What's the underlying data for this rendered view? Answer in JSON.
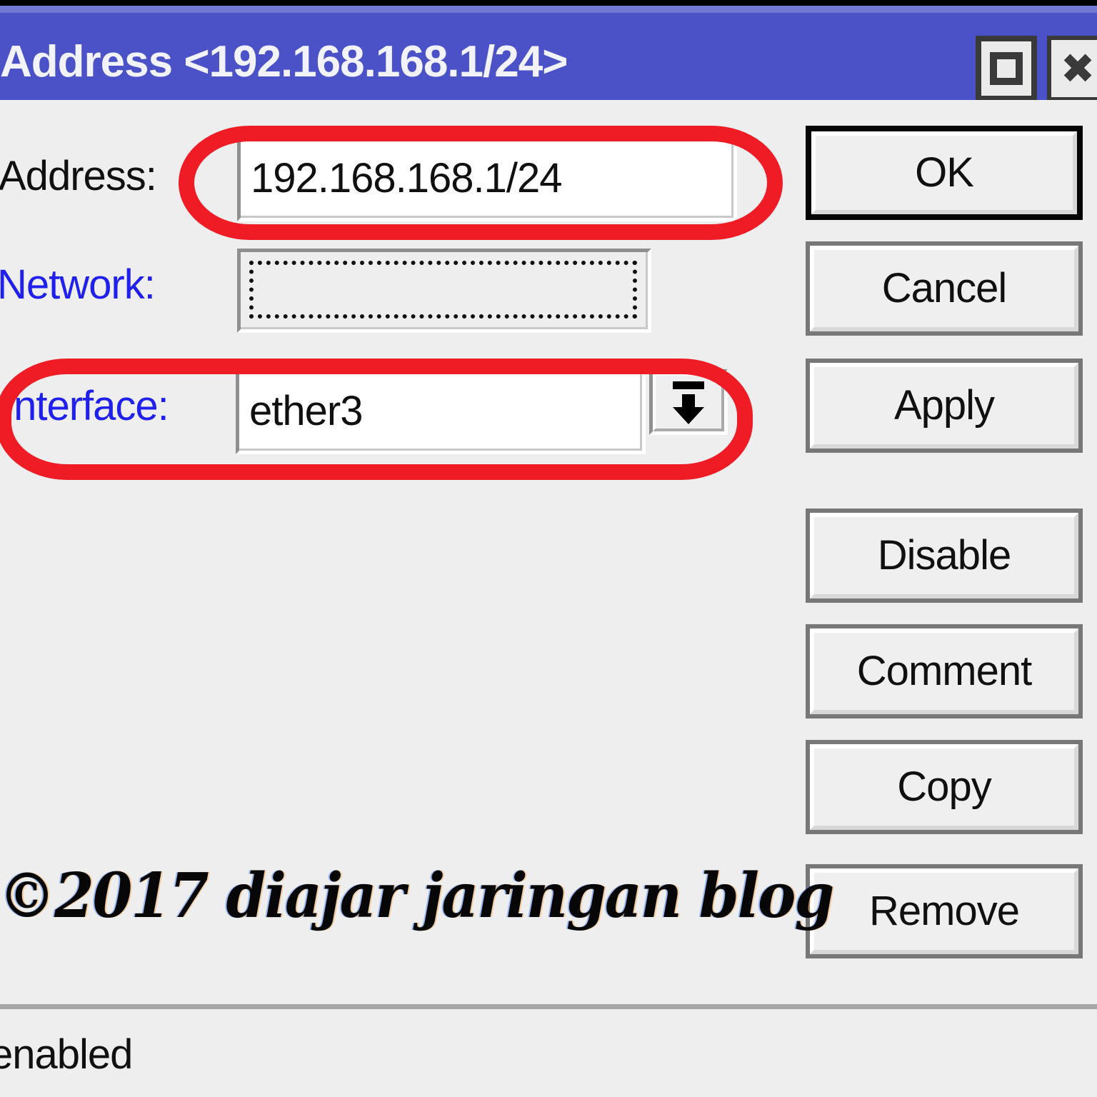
{
  "window": {
    "title": "Address <192.168.168.1/24>",
    "titlebar_color": "#4b52c8",
    "face_color": "#eeeeee",
    "buttons": [
      {
        "name": "maximize",
        "glyph": "square"
      },
      {
        "name": "close",
        "glyph": "✖"
      }
    ]
  },
  "form": {
    "address": {
      "label": "Address:",
      "value": "192.168.168.1/24",
      "label_color": "#101010"
    },
    "network": {
      "label": "Network:",
      "value": "",
      "placeholder": "",
      "label_color": "#2020ee",
      "dropdown_icon": "triangle-down-icon"
    },
    "interface": {
      "label": "Interface:",
      "value": "ether3",
      "label_color": "#2020ee",
      "dropdown_icon": "drop-to-bottom-icon"
    }
  },
  "actions": [
    {
      "label": "OK",
      "default": true
    },
    {
      "label": "Cancel",
      "default": false
    },
    {
      "label": "Apply",
      "default": false
    },
    {
      "label": "Disable",
      "default": false
    },
    {
      "label": "Comment",
      "default": false
    },
    {
      "label": "Copy",
      "default": false
    },
    {
      "label": "Remove",
      "default": false
    }
  ],
  "status": {
    "text": "enabled"
  },
  "watermark": {
    "text": "©2017 diajar jaringan blog"
  },
  "annotations": {
    "color": "#ef1c26",
    "shapes": [
      {
        "name": "address-highlight",
        "target": "address-field"
      },
      {
        "name": "interface-highlight",
        "target": "interface-row"
      }
    ]
  }
}
